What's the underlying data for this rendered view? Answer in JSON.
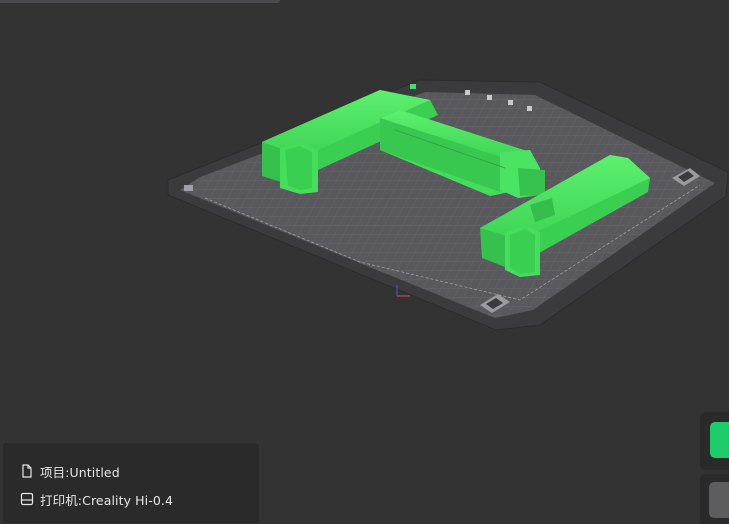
{
  "info": {
    "project_label": "项目:Untitled",
    "printer_label": "打印机:Creality Hi-0.4"
  },
  "colors": {
    "background": "#333334",
    "bed": "#5a5a5e",
    "model": "#43e15e",
    "accent": "#1ccb6a"
  },
  "icons": {
    "project": "file-icon",
    "printer": "printer-icon"
  }
}
